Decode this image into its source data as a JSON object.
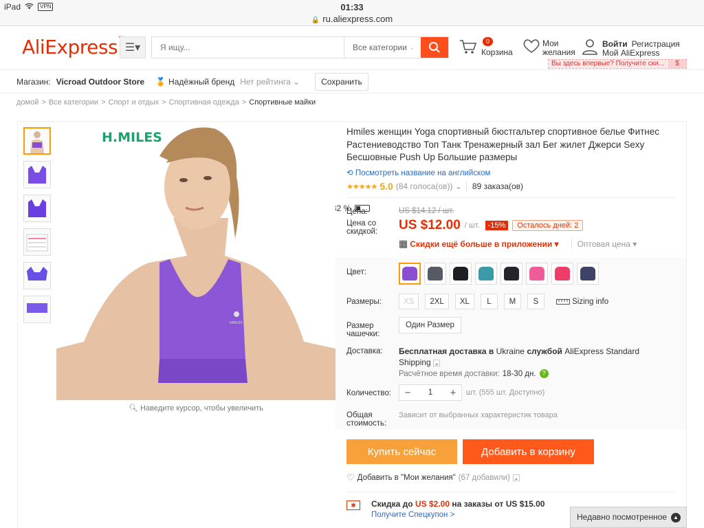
{
  "status": {
    "device": "iPad",
    "vpn": "VPN",
    "time": "01:33",
    "battery": "32 %"
  },
  "url": "ru.aliexpress.com",
  "header": {
    "logo": "AliExpress",
    "search_placeholder": "Я ищу...",
    "search_category": "Все категории",
    "cart_count": "0",
    "cart_label": "Корзина",
    "wish_line1": "Мои",
    "wish_line2": "желания",
    "login": "Войти",
    "register": "Регистрация",
    "my_ali": "Мой AliExpress",
    "promo": "Вы здесь впервые? Получите ски...",
    "promo_icon": "$"
  },
  "storebar": {
    "label": "Магазин:",
    "store_name": "Vicroad Outdoor Store",
    "brand": "Надёжный бренд",
    "rating": "Нет рейтинга",
    "save": "Сохранить"
  },
  "breadcrumb": [
    "домой",
    "Все категории",
    "Спорт и отдых",
    "Спортивная одежда",
    "Спортивные майки"
  ],
  "product": {
    "brand_mark": "H.MILES",
    "zoom_hint": "Наведите курсор, чтобы увеличить",
    "title": "Hmiles женщин Yoga спортивный бюстгальтер спортивное белье Фитнес Растениеводство Топ Танк Тренажерный зал Бег жилет Джерси Sexy Бесшовные Push Up Большие размеры",
    "translate": "Посмотреть название на английском",
    "stars": "★★★★★",
    "score": "5.0",
    "votes": "(84 голоса(ов))",
    "orders": "89 заказа(ов)",
    "price_label": "Цена:",
    "old_price": "US $14.12 / шт.",
    "sale_label": "Цена со скидкой:",
    "price": "US $12.00",
    "price_unit": "/ шт.",
    "discount": "-15%",
    "days_left": "Осталось дней: 2",
    "app_deal": "Скидки ещё больше в приложении",
    "wholesale": "Оптовая цена",
    "color_label": "Цвет:",
    "colors": [
      "#8a4fd0",
      "#555a63",
      "#1e1e24",
      "#3a9aa8",
      "#24252c",
      "#ef5c9a",
      "#ef3d6a",
      "#3d4266"
    ],
    "size_label": "Размеры:",
    "sizes": [
      "XS",
      "2XL",
      "XL",
      "L",
      "M",
      "S"
    ],
    "size_info": "Sizing info",
    "cup_label": "Размер чашечки:",
    "cup_value": "Один Размер",
    "delivery_label": "Доставка:",
    "delivery_pre": "Бесплатная доставка в",
    "delivery_country": "Ukraine",
    "delivery_mid": "службой",
    "delivery_service": "AliExpress Standard Shipping",
    "eta_label": "Расчётное время доставки:",
    "eta_value": "18-30 дн.",
    "qty_label": "Количество:",
    "qty_value": "1",
    "qty_avail": "шт. (555 шт. Доступно)",
    "total_label": "Общая стоимость:",
    "total_value": "Зависит от выбранных характеристик товара",
    "buy_now": "Купить сейчас",
    "add_cart": "Добавить в корзину",
    "wish_add": "Добавить в \"Мои желания\"",
    "wish_count": "(67 добавили)",
    "coupon_pre": "Скидка до",
    "coupon_amount": "US $2.00",
    "coupon_post": "на заказы от US $15.00",
    "coupon_link": "Получите Спецкупон >"
  },
  "recent": "Недавно посмотренное"
}
